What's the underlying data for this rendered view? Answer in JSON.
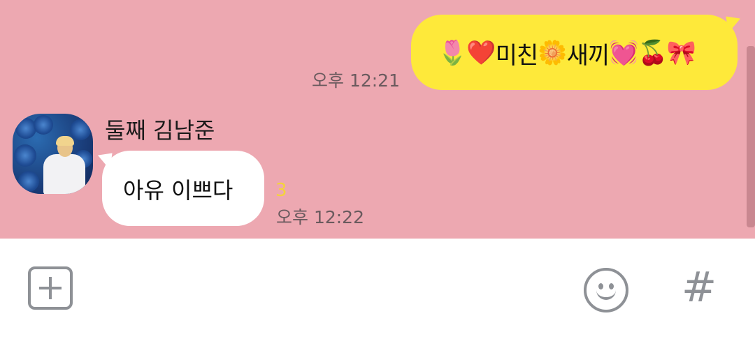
{
  "sent_message": {
    "parts": [
      {
        "type": "emoji",
        "value": "🌷"
      },
      {
        "type": "emoji",
        "value": "❤️"
      },
      {
        "type": "text",
        "value": "미친"
      },
      {
        "type": "emoji",
        "value": "🌼"
      },
      {
        "type": "text",
        "value": "새끼"
      },
      {
        "type": "emoji",
        "value": "💓"
      },
      {
        "type": "emoji",
        "value": "🍒"
      },
      {
        "type": "emoji",
        "value": "🎀"
      }
    ],
    "time": "오후 12:21"
  },
  "received_message": {
    "sender": "둘째 김남준",
    "text": "아유 이쁘다",
    "unread": "3",
    "time": "오후 12:22"
  },
  "input_bar": {
    "add_icon": "plus-square-icon",
    "emoji_icon": "smiley-icon",
    "hashtag_label": "#"
  },
  "colors": {
    "chat_background": "#eda8b1",
    "sent_bubble": "#fee93a",
    "received_bubble": "#ffffff",
    "unread_count": "#f4d43a",
    "icon_gray": "#8e9196"
  }
}
